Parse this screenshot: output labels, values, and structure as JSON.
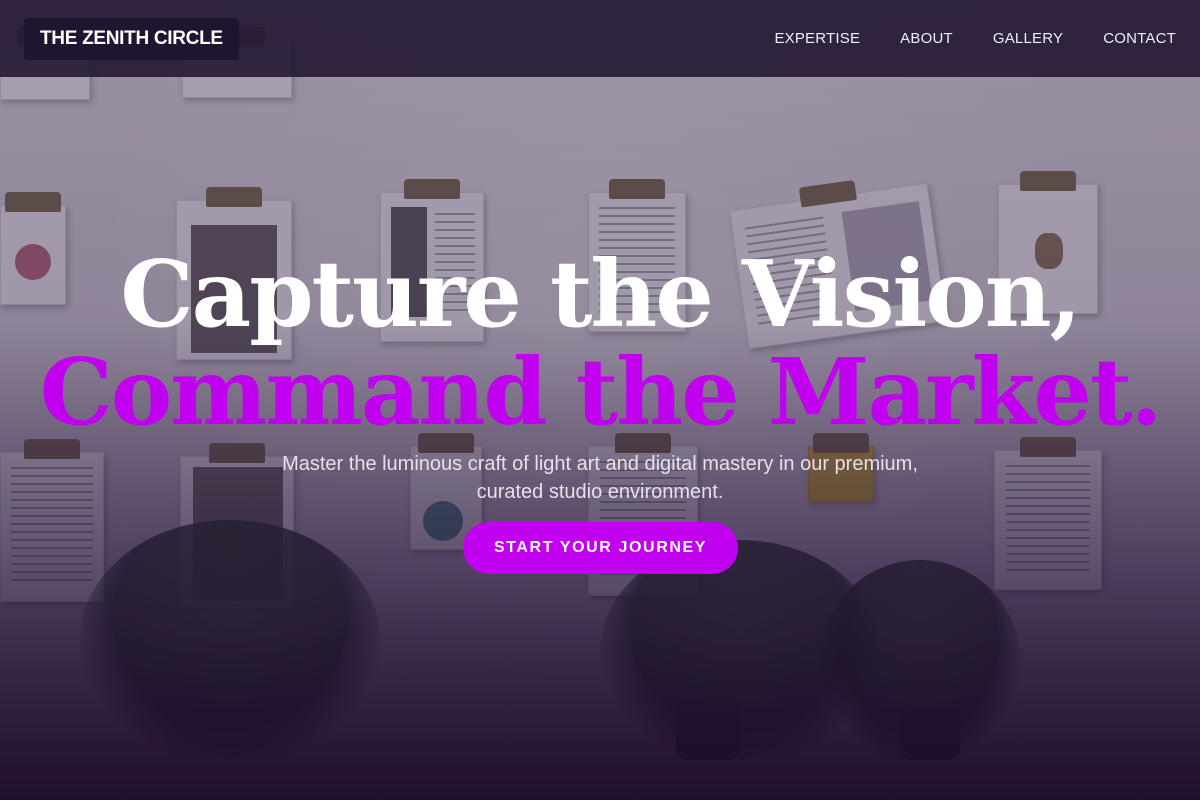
{
  "header": {
    "brand": "THE ZENITH CIRCLE",
    "nav": [
      {
        "label": "EXPERTISE"
      },
      {
        "label": "ABOUT"
      },
      {
        "label": "GALLERY"
      },
      {
        "label": "CONTACT"
      }
    ]
  },
  "hero": {
    "headline_line1": "Capture the Vision,",
    "headline_line2": "Command the Market.",
    "subtitle": "Master the luminous craft of light art and digital mastery in our premium, curated studio environment.",
    "cta_label": "START YOUR JOURNEY",
    "background_image": "studio wall with clipped magazine pages and potted plants"
  },
  "colors": {
    "accent": "#c200f0",
    "nav_background": "#261a34",
    "overlay": "#2a1d3a",
    "headline_primary": "#ffffff"
  }
}
